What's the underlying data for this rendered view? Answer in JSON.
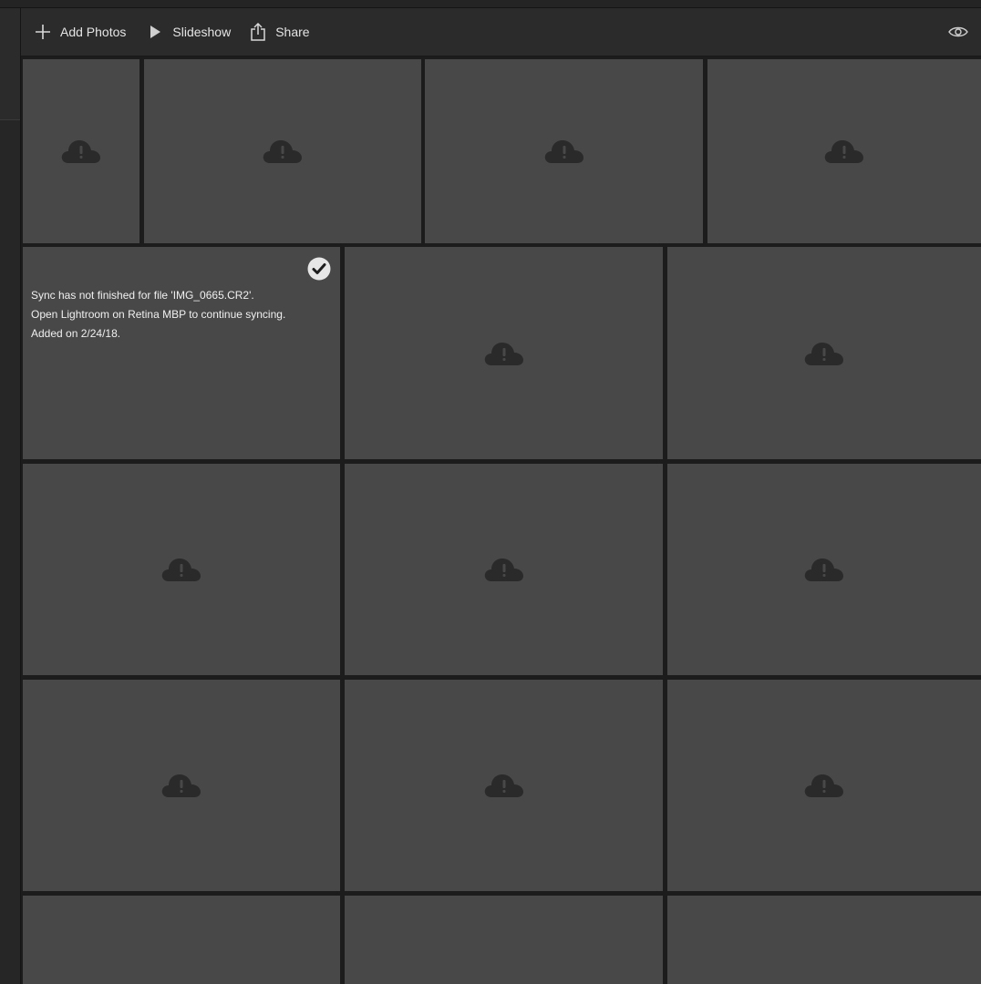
{
  "toolbar": {
    "add_photos_label": "Add Photos",
    "slideshow_label": "Slideshow",
    "share_label": "Share",
    "icons": {
      "add": "plus-icon",
      "slideshow": "play-icon",
      "share": "share-icon",
      "view": "eye-icon"
    }
  },
  "grid": {
    "tile_icon": "cloud-alert-icon",
    "selected_tile": {
      "message_line1": "Sync has not finished for file 'IMG_0665.CR2'.",
      "message_line2": "Open Lightroom on Retina MBP to continue syncing.",
      "message_line3": "Added on 2/24/18.",
      "selected": true,
      "icon": "checkmark-icon"
    }
  },
  "colors": {
    "background": "#1c1c1c",
    "toolbar": "#2b2b2b",
    "tile": "#484848",
    "cloud_icon": "#2a2a2a",
    "text": "#e8e8e8"
  }
}
